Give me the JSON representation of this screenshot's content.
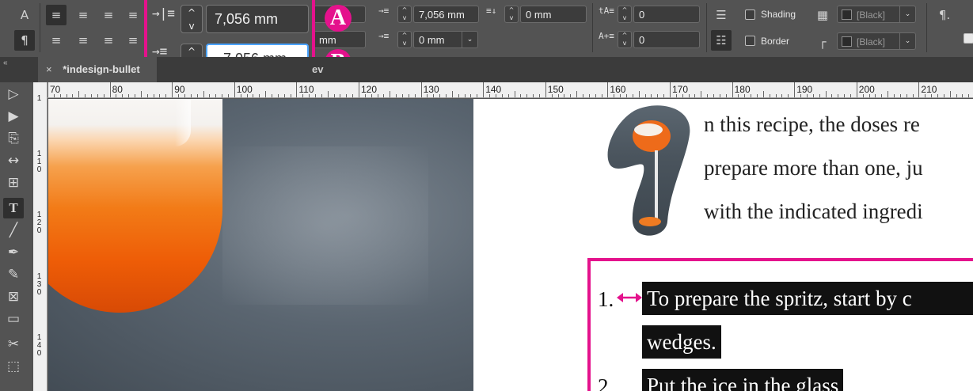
{
  "control_panel": {
    "left_indent_value": "7,056 mm",
    "first_line_indent_value": "–7,056 mm",
    "partial_left_value": "mm",
    "right_indent_value": "7,056 mm",
    "space_before_value": "0 mm",
    "space_after_value": "0 mm",
    "dropcap_lines_value": "0",
    "dropcap_chars_value": "0",
    "shading_label": "Shading",
    "border_label": "Border",
    "shading_color": "[Black]",
    "border_color": "[Black]",
    "badge_a": "A",
    "badge_b": "B"
  },
  "document_tab": {
    "close": "×",
    "title": "*indesign-bullet",
    "overflow": "ev"
  },
  "ruler": {
    "h_labels": [
      "70",
      "80",
      "90",
      "100",
      "110",
      "120",
      "130",
      "140",
      "150",
      "160",
      "170",
      "180",
      "190",
      "200",
      "210"
    ],
    "v_labels": [
      "1",
      "1\n1\n0",
      "1\n2\n0",
      "1\n3\n0",
      "1\n4\n0"
    ]
  },
  "document": {
    "line1": "n this recipe, the doses re",
    "line2": "prepare more than one, ju",
    "line3": "with the indicated ingredi",
    "item1_num": "1.",
    "item1_text": "To prepare the spritz, start by c",
    "item1_cont": "wedges.",
    "item2_num": "2.",
    "item2_text": "Put the ice in the glass"
  },
  "colors": {
    "highlight": "#e4128c",
    "panel": "#535353",
    "field_active_border": "#4aa3ff"
  }
}
